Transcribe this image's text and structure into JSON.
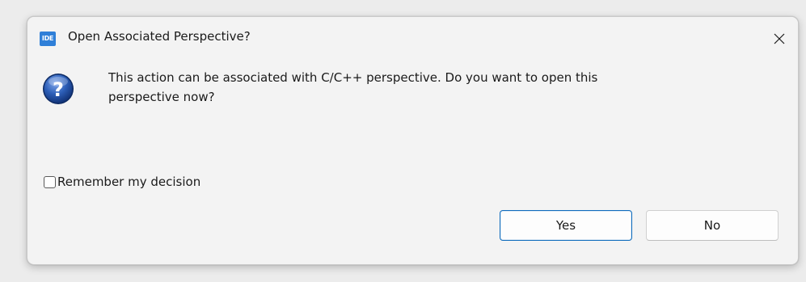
{
  "dialog": {
    "app_icon_label": "IDE",
    "title": "Open Associated Perspective?",
    "close_icon": "close-icon",
    "question_icon": "question-icon",
    "message_line1": "This action can be associated with C/C++ perspective. Do you want to open this",
    "message_line2": "perspective now?",
    "remember_label": "Remember my decision",
    "remember_checked": false,
    "yes_label": "Yes",
    "no_label": "No"
  },
  "colors": {
    "accent": "#0f6cbd",
    "app_icon": "#2f7fd8",
    "question_icon": "#1f4e9e"
  }
}
